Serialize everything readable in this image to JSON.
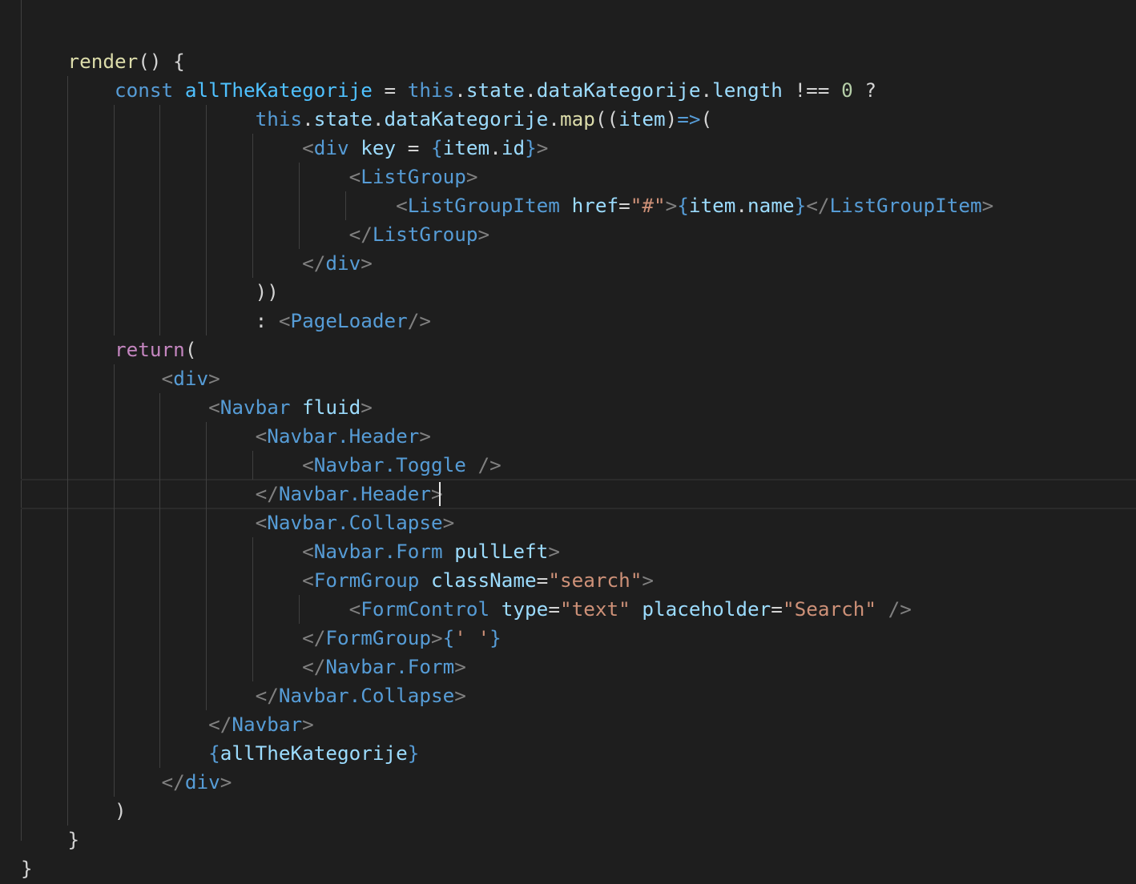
{
  "editor": {
    "language": "javascript-jsx",
    "theme": "dark",
    "colors": {
      "background": "#1e1e1e",
      "default": "#d4d4d4",
      "function": "#dcdcaa",
      "keyword": "#569cd6",
      "control": "#c586c0",
      "variable": "#9cdcfe",
      "const": "#4fc1ff",
      "number": "#b5cea8",
      "string": "#ce9178",
      "tag": "#569cd6",
      "bracket": "#808080",
      "guide": "#404040"
    },
    "cursor": {
      "line": 17,
      "after_column": 29
    },
    "lines": [
      {
        "indent": 0,
        "tokens": []
      },
      {
        "indent": 1,
        "tokens": [
          {
            "t": "render",
            "c": "function"
          },
          {
            "t": "() {",
            "c": "default"
          }
        ]
      },
      {
        "indent": 2,
        "tokens": [
          {
            "t": "const ",
            "c": "keyword"
          },
          {
            "t": "allTheKategorije",
            "c": "const"
          },
          {
            "t": " = ",
            "c": "default"
          },
          {
            "t": "this",
            "c": "keyword"
          },
          {
            "t": ".",
            "c": "default"
          },
          {
            "t": "state",
            "c": "variable"
          },
          {
            "t": ".",
            "c": "default"
          },
          {
            "t": "dataKategorije",
            "c": "variable"
          },
          {
            "t": ".",
            "c": "default"
          },
          {
            "t": "length",
            "c": "variable"
          },
          {
            "t": " !== ",
            "c": "default"
          },
          {
            "t": "0",
            "c": "number"
          },
          {
            "t": " ?",
            "c": "default"
          }
        ]
      },
      {
        "indent": 5,
        "tokens": [
          {
            "t": "this",
            "c": "keyword"
          },
          {
            "t": ".",
            "c": "default"
          },
          {
            "t": "state",
            "c": "variable"
          },
          {
            "t": ".",
            "c": "default"
          },
          {
            "t": "dataKategorije",
            "c": "variable"
          },
          {
            "t": ".",
            "c": "default"
          },
          {
            "t": "map",
            "c": "function"
          },
          {
            "t": "((",
            "c": "default"
          },
          {
            "t": "item",
            "c": "variable"
          },
          {
            "t": ")",
            "c": "default"
          },
          {
            "t": "=>",
            "c": "keyword"
          },
          {
            "t": "(",
            "c": "default"
          }
        ]
      },
      {
        "indent": 6,
        "tokens": [
          {
            "t": "<",
            "c": "bracket"
          },
          {
            "t": "div",
            "c": "tag"
          },
          {
            "t": " ",
            "c": "default"
          },
          {
            "t": "key",
            "c": "variable"
          },
          {
            "t": " = ",
            "c": "default"
          },
          {
            "t": "{",
            "c": "keyword"
          },
          {
            "t": "item",
            "c": "variable"
          },
          {
            "t": ".",
            "c": "default"
          },
          {
            "t": "id",
            "c": "variable"
          },
          {
            "t": "}",
            "c": "keyword"
          },
          {
            "t": ">",
            "c": "bracket"
          }
        ]
      },
      {
        "indent": 7,
        "tokens": [
          {
            "t": "<",
            "c": "bracket"
          },
          {
            "t": "ListGroup",
            "c": "tag"
          },
          {
            "t": ">",
            "c": "bracket"
          }
        ]
      },
      {
        "indent": 8,
        "tokens": [
          {
            "t": "<",
            "c": "bracket"
          },
          {
            "t": "ListGroupItem",
            "c": "tag"
          },
          {
            "t": " ",
            "c": "default"
          },
          {
            "t": "href",
            "c": "variable"
          },
          {
            "t": "=",
            "c": "default"
          },
          {
            "t": "\"#\"",
            "c": "string"
          },
          {
            "t": ">",
            "c": "bracket"
          },
          {
            "t": "{",
            "c": "keyword"
          },
          {
            "t": "item",
            "c": "variable"
          },
          {
            "t": ".",
            "c": "default"
          },
          {
            "t": "name",
            "c": "variable"
          },
          {
            "t": "}",
            "c": "keyword"
          },
          {
            "t": "</",
            "c": "bracket"
          },
          {
            "t": "ListGroupItem",
            "c": "tag"
          },
          {
            "t": ">",
            "c": "bracket"
          }
        ]
      },
      {
        "indent": 7,
        "tokens": [
          {
            "t": "</",
            "c": "bracket"
          },
          {
            "t": "ListGroup",
            "c": "tag"
          },
          {
            "t": ">",
            "c": "bracket"
          }
        ]
      },
      {
        "indent": 6,
        "tokens": [
          {
            "t": "</",
            "c": "bracket"
          },
          {
            "t": "div",
            "c": "tag"
          },
          {
            "t": ">",
            "c": "bracket"
          }
        ]
      },
      {
        "indent": 5,
        "tokens": [
          {
            "t": "))",
            "c": "default"
          }
        ]
      },
      {
        "indent": 5,
        "tokens": [
          {
            "t": ": ",
            "c": "default"
          },
          {
            "t": "<",
            "c": "bracket"
          },
          {
            "t": "PageLoader",
            "c": "tag"
          },
          {
            "t": "/>",
            "c": "bracket"
          }
        ]
      },
      {
        "indent": 2,
        "tokens": [
          {
            "t": "return",
            "c": "control"
          },
          {
            "t": "(",
            "c": "default"
          }
        ]
      },
      {
        "indent": 3,
        "tokens": [
          {
            "t": "<",
            "c": "bracket"
          },
          {
            "t": "div",
            "c": "tag"
          },
          {
            "t": ">",
            "c": "bracket"
          }
        ]
      },
      {
        "indent": 4,
        "tokens": [
          {
            "t": "<",
            "c": "bracket"
          },
          {
            "t": "Navbar",
            "c": "tag"
          },
          {
            "t": " ",
            "c": "default"
          },
          {
            "t": "fluid",
            "c": "variable"
          },
          {
            "t": ">",
            "c": "bracket"
          }
        ]
      },
      {
        "indent": 5,
        "tokens": [
          {
            "t": "<",
            "c": "bracket"
          },
          {
            "t": "Navbar.Header",
            "c": "tag"
          },
          {
            "t": ">",
            "c": "bracket"
          }
        ]
      },
      {
        "indent": 6,
        "tokens": [
          {
            "t": "<",
            "c": "bracket"
          },
          {
            "t": "Navbar.Toggle",
            "c": "tag"
          },
          {
            "t": " ",
            "c": "default"
          },
          {
            "t": "/>",
            "c": "bracket"
          }
        ]
      },
      {
        "indent": 5,
        "tokens": [
          {
            "t": "</",
            "c": "bracket"
          },
          {
            "t": "Navbar.Header",
            "c": "tag"
          },
          {
            "t": ">",
            "c": "bracket"
          }
        ]
      },
      {
        "indent": 5,
        "tokens": [
          {
            "t": "<",
            "c": "bracket"
          },
          {
            "t": "Navbar.Collapse",
            "c": "tag"
          },
          {
            "t": ">",
            "c": "bracket"
          }
        ]
      },
      {
        "indent": 6,
        "tokens": [
          {
            "t": "<",
            "c": "bracket"
          },
          {
            "t": "Navbar.Form",
            "c": "tag"
          },
          {
            "t": " ",
            "c": "default"
          },
          {
            "t": "pullLeft",
            "c": "variable"
          },
          {
            "t": ">",
            "c": "bracket"
          }
        ]
      },
      {
        "indent": 6,
        "tokens": [
          {
            "t": "<",
            "c": "bracket"
          },
          {
            "t": "FormGroup",
            "c": "tag"
          },
          {
            "t": " ",
            "c": "default"
          },
          {
            "t": "className",
            "c": "variable"
          },
          {
            "t": "=",
            "c": "default"
          },
          {
            "t": "\"search\"",
            "c": "string"
          },
          {
            "t": ">",
            "c": "bracket"
          }
        ]
      },
      {
        "indent": 7,
        "tokens": [
          {
            "t": "<",
            "c": "bracket"
          },
          {
            "t": "FormControl",
            "c": "tag"
          },
          {
            "t": " ",
            "c": "default"
          },
          {
            "t": "type",
            "c": "variable"
          },
          {
            "t": "=",
            "c": "default"
          },
          {
            "t": "\"text\"",
            "c": "string"
          },
          {
            "t": " ",
            "c": "default"
          },
          {
            "t": "placeholder",
            "c": "variable"
          },
          {
            "t": "=",
            "c": "default"
          },
          {
            "t": "\"Search\"",
            "c": "string"
          },
          {
            "t": " ",
            "c": "default"
          },
          {
            "t": "/>",
            "c": "bracket"
          }
        ]
      },
      {
        "indent": 6,
        "tokens": [
          {
            "t": "</",
            "c": "bracket"
          },
          {
            "t": "FormGroup",
            "c": "tag"
          },
          {
            "t": ">",
            "c": "bracket"
          },
          {
            "t": "{",
            "c": "keyword"
          },
          {
            "t": "' '",
            "c": "string"
          },
          {
            "t": "}",
            "c": "keyword"
          }
        ]
      },
      {
        "indent": 6,
        "tokens": [
          {
            "t": "</",
            "c": "bracket"
          },
          {
            "t": "Navbar.Form",
            "c": "tag"
          },
          {
            "t": ">",
            "c": "bracket"
          }
        ]
      },
      {
        "indent": 5,
        "tokens": [
          {
            "t": "</",
            "c": "bracket"
          },
          {
            "t": "Navbar.Collapse",
            "c": "tag"
          },
          {
            "t": ">",
            "c": "bracket"
          }
        ]
      },
      {
        "indent": 4,
        "tokens": [
          {
            "t": "</",
            "c": "bracket"
          },
          {
            "t": "Navbar",
            "c": "tag"
          },
          {
            "t": ">",
            "c": "bracket"
          }
        ]
      },
      {
        "indent": 4,
        "tokens": [
          {
            "t": "{",
            "c": "keyword"
          },
          {
            "t": "allTheKategorije",
            "c": "variable"
          },
          {
            "t": "}",
            "c": "keyword"
          }
        ]
      },
      {
        "indent": 3,
        "tokens": [
          {
            "t": "</",
            "c": "bracket"
          },
          {
            "t": "div",
            "c": "tag"
          },
          {
            "t": ">",
            "c": "bracket"
          }
        ]
      },
      {
        "indent": 2,
        "tokens": [
          {
            "t": ")",
            "c": "default"
          }
        ]
      },
      {
        "indent": 1,
        "tokens": [
          {
            "t": "}",
            "c": "default"
          }
        ]
      },
      {
        "indent": 0,
        "tokens": [
          {
            "t": "}",
            "c": "default"
          }
        ]
      }
    ]
  }
}
